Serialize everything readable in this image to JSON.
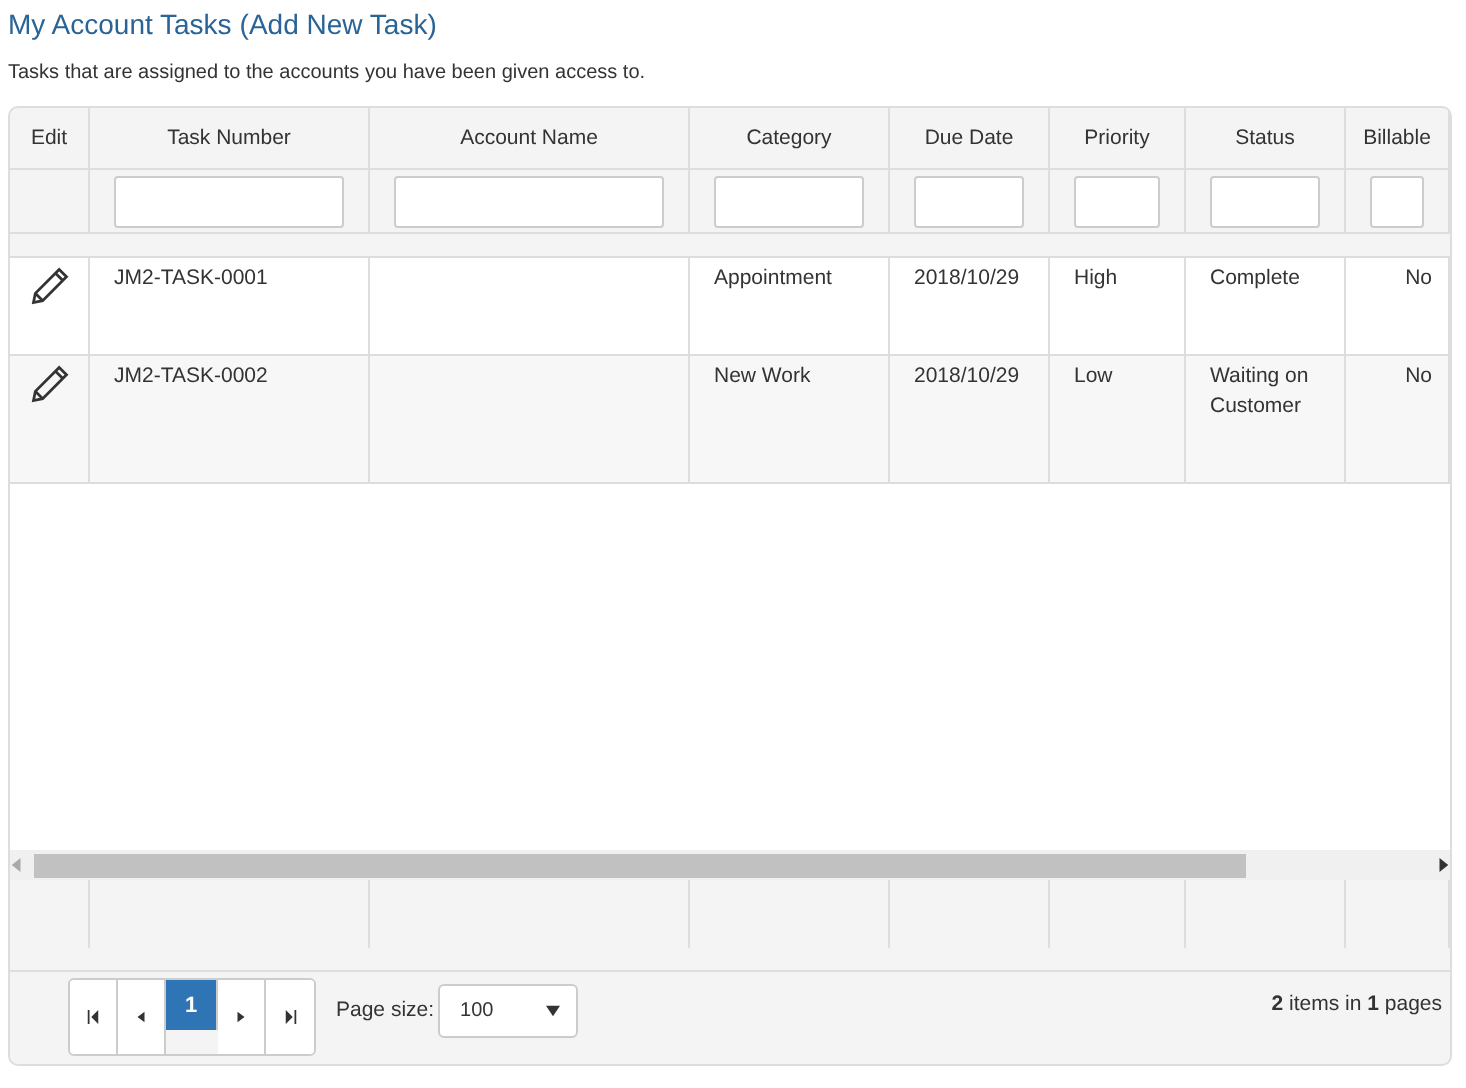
{
  "heading": {
    "title": "My Account Tasks",
    "link": "(Add New Task)"
  },
  "description": "Tasks that are assigned to the accounts you have been given access to.",
  "table": {
    "columns": [
      {
        "label": "Edit",
        "filter": false
      },
      {
        "label": "Task Number",
        "filter": true
      },
      {
        "label": "Account Name",
        "filter": true
      },
      {
        "label": "Category",
        "filter": true
      },
      {
        "label": "Due Date",
        "filter": true
      },
      {
        "label": "Priority",
        "filter": true
      },
      {
        "label": "Status",
        "filter": true
      },
      {
        "label": "Billable",
        "filter": true
      }
    ],
    "rows": [
      {
        "task_number": "JM2-TASK-0001",
        "account_name": "",
        "category": "Appointment",
        "due_date": "2018/10/29",
        "priority": "High",
        "status": "Complete",
        "billable": "No"
      },
      {
        "task_number": "JM2-TASK-0002",
        "account_name": "",
        "category": "New Work",
        "due_date": "2018/10/29",
        "priority": "Low",
        "status": "Waiting on Customer",
        "billable": "No"
      }
    ]
  },
  "pager": {
    "pages": [
      {
        "label": "1",
        "selected": true
      }
    ],
    "page_size_label": "Page size:",
    "page_size": "100",
    "summary": "**2** items in **1** pages"
  }
}
